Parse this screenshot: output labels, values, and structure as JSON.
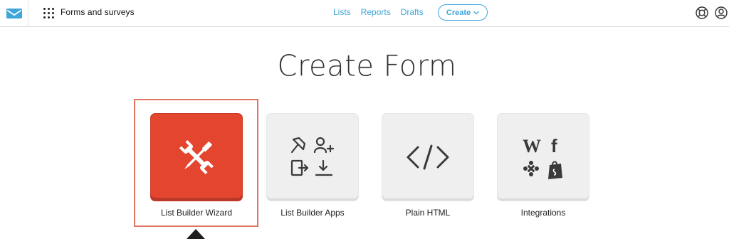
{
  "header": {
    "app_title": "Forms and surveys",
    "nav": [
      {
        "label": "Lists"
      },
      {
        "label": "Reports"
      },
      {
        "label": "Drafts"
      }
    ],
    "create_label": "Create",
    "icons": {
      "logo": "envelope-logo-icon",
      "apps": "apps-grid-icon",
      "help": "help-lifebuoy-icon",
      "account": "user-account-icon"
    }
  },
  "main": {
    "title": "Create Form",
    "options": [
      {
        "label": "List Builder Wizard",
        "icon": "wrench-screwdriver-icon",
        "active": true
      },
      {
        "label": "List Builder Apps",
        "icon": "apps-tools-icon",
        "active": false
      },
      {
        "label": "Plain HTML",
        "icon": "code-brackets-icon",
        "active": false
      },
      {
        "label": "Integrations",
        "icon": "integrations-icon",
        "active": false
      }
    ]
  },
  "colors": {
    "accent": "#3fa6d9",
    "active_card": "#e3452f",
    "card_bg": "#efefef",
    "highlight": "#e07465"
  }
}
